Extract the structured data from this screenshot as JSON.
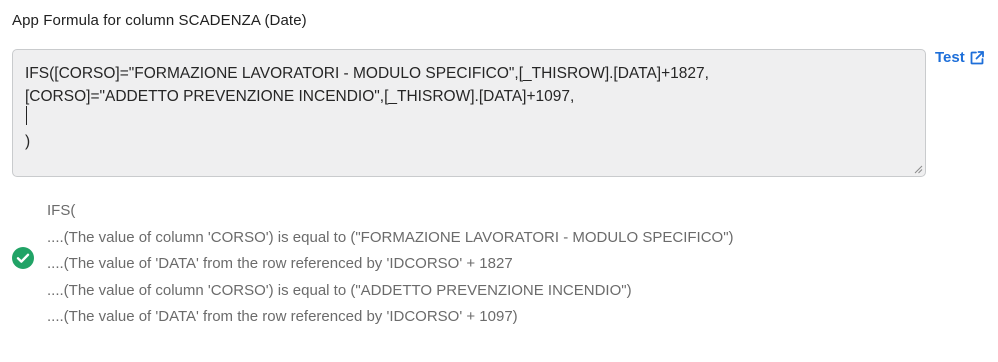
{
  "header": {
    "title": "App Formula for column SCADENZA (Date)"
  },
  "editor": {
    "lines": [
      "IFS([CORSO]=\"FORMAZIONE LAVORATORI - MODULO SPECIFICO\",[_THISROW].[DATA]+1827,",
      "[CORSO]=\"ADDETTO PREVENZIONE INCENDIO\",[_THISROW].[DATA]+1097,",
      "",
      ")"
    ]
  },
  "test": {
    "label": "Test",
    "icon": "external-link-icon",
    "color": "#1e6fd9"
  },
  "validation": {
    "status": "valid",
    "icon": "check-circle-icon",
    "color": "#21a366",
    "lines": [
      "IFS(",
      "....(The value of column 'CORSO') is equal to (\"FORMAZIONE LAVORATORI - MODULO SPECIFICO\")",
      "....(The value of 'DATA' from the row referenced by 'IDCORSO' + 1827",
      "....(The value of column 'CORSO') is equal to (\"ADDETTO PREVENZIONE INCENDIO\")",
      "....(The value of 'DATA' from the row referenced by 'IDCORSO' + 1097)"
    ]
  }
}
